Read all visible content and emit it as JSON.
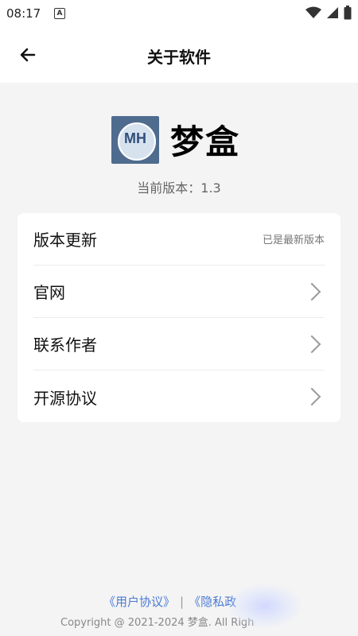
{
  "status_bar": {
    "time": "08:17",
    "notification_icon": "a-icon",
    "icons": [
      "wifi-icon",
      "signal-icon",
      "battery-icon"
    ]
  },
  "header": {
    "back_icon": "arrow-left-icon",
    "title": "关于软件"
  },
  "app": {
    "logo_text": "MH",
    "name": "梦盒",
    "version_text": "当前版本：1.3"
  },
  "menu": {
    "items": [
      {
        "label": "版本更新",
        "value": "已是最新版本"
      },
      {
        "label": "官网",
        "icon": "chevron-right-icon"
      },
      {
        "label": "联系作者",
        "icon": "chevron-right-icon"
      },
      {
        "label": "开源协议",
        "icon": "chevron-right-icon"
      }
    ]
  },
  "footer": {
    "user_agreement": "《用户协议》",
    "separator": "|",
    "privacy_policy": "《隐私政",
    "copyright": "Copyright @ 2021-2024 梦盒. All Righ"
  },
  "colors": {
    "link": "#4b7bd6",
    "background": "#f4f4f4",
    "card": "#ffffff"
  }
}
